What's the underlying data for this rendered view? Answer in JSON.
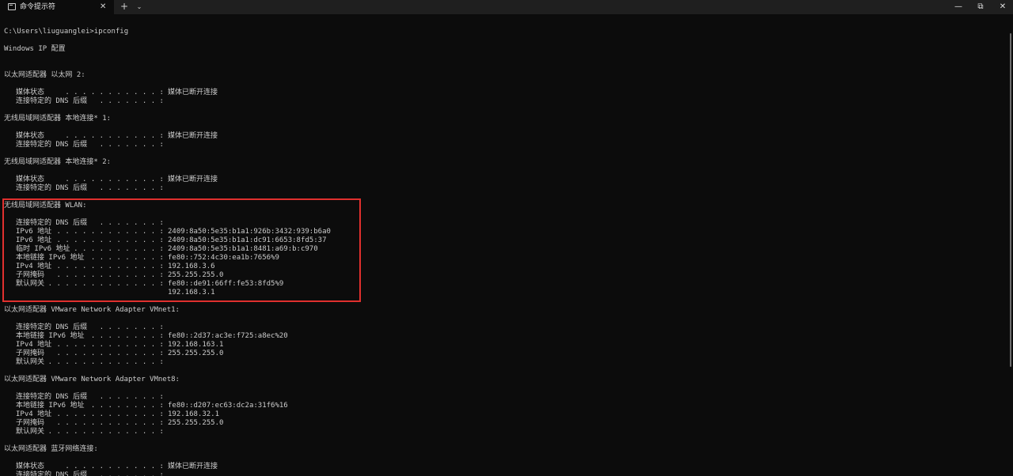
{
  "window": {
    "tab_title": "命令提示符",
    "tab_close": "✕",
    "new_tab": "+",
    "tab_dropdown": "⌄",
    "minimize": "—",
    "maximize": "⧉",
    "close": "✕"
  },
  "console": {
    "prompt": "C:\\Users\\liuguanglei>ipconfig",
    "heading": "Windows IP 配置",
    "adapters": [
      {
        "title": "以太网适配器 以太网 2:",
        "rows": [
          {
            "key": "媒体状态",
            "dots": ". . . . . . . . . . . :",
            "value": "媒体已断开连接"
          },
          {
            "key": "连接特定的 DNS 后缀",
            "dots": ". . . . . . . :",
            "value": ""
          }
        ]
      },
      {
        "title": "无线局域网适配器 本地连接* 1:",
        "rows": [
          {
            "key": "媒体状态",
            "dots": ". . . . . . . . . . . :",
            "value": "媒体已断开连接"
          },
          {
            "key": "连接特定的 DNS 后缀",
            "dots": ". . . . . . . :",
            "value": ""
          }
        ]
      },
      {
        "title": "无线局域网适配器 本地连接* 2:",
        "rows": [
          {
            "key": "媒体状态",
            "dots": ". . . . . . . . . . . :",
            "value": "媒体已断开连接"
          },
          {
            "key": "连接特定的 DNS 后缀",
            "dots": ". . . . . . . :",
            "value": ""
          }
        ]
      },
      {
        "title": "无线局域网适配器 WLAN:",
        "rows": [
          {
            "key": "连接特定的 DNS 后缀",
            "dots": ". . . . . . . :",
            "value": ""
          },
          {
            "key": "IPv6 地址",
            "dots": ". . . . . . . . . . . . :",
            "value": "2409:8a50:5e35:b1a1:926b:3432:939:b6a0"
          },
          {
            "key": "IPv6 地址",
            "dots": ". . . . . . . . . . . . :",
            "value": "2409:8a50:5e35:b1a1:dc91:6653:8fd5:37"
          },
          {
            "key": "临时 IPv6 地址",
            "dots": ". . . . . . . . . . :",
            "value": "2409:8a50:5e35:b1a1:8481:a69:b:c970"
          },
          {
            "key": "本地链接 IPv6 地址",
            "dots": ". . . . . . . . :",
            "value": "fe80::752:4c30:ea1b:7656%9"
          },
          {
            "key": "IPv4 地址",
            "dots": ". . . . . . . . . . . . :",
            "value": "192.168.3.6"
          },
          {
            "key": "子网掩码",
            "dots": ". . . . . . . . . . . . :",
            "value": "255.255.255.0"
          },
          {
            "key": "默认网关",
            "dots": ". . . . . . . . . . . . . :",
            "value": "fe80::de91:66ff:fe53:8fd5%9"
          },
          {
            "key": "",
            "dots": "",
            "value": "192.168.3.1"
          }
        ]
      },
      {
        "title": "以太网适配器 VMware Network Adapter VMnet1:",
        "rows": [
          {
            "key": "连接特定的 DNS 后缀",
            "dots": ". . . . . . . :",
            "value": ""
          },
          {
            "key": "本地链接 IPv6 地址",
            "dots": ". . . . . . . . :",
            "value": "fe80::2d37:ac3e:f725:a8ec%20"
          },
          {
            "key": "IPv4 地址",
            "dots": ". . . . . . . . . . . . :",
            "value": "192.168.163.1"
          },
          {
            "key": "子网掩码",
            "dots": ". . . . . . . . . . . . :",
            "value": "255.255.255.0"
          },
          {
            "key": "默认网关",
            "dots": ". . . . . . . . . . . . . :",
            "value": ""
          }
        ]
      },
      {
        "title": "以太网适配器 VMware Network Adapter VMnet8:",
        "rows": [
          {
            "key": "连接特定的 DNS 后缀",
            "dots": ". . . . . . . :",
            "value": ""
          },
          {
            "key": "本地链接 IPv6 地址",
            "dots": ". . . . . . . . :",
            "value": "fe80::d207:ec63:dc2a:31f6%16"
          },
          {
            "key": "IPv4 地址",
            "dots": ". . . . . . . . . . . . :",
            "value": "192.168.32.1"
          },
          {
            "key": "子网掩码",
            "dots": ". . . . . . . . . . . . :",
            "value": "255.255.255.0"
          },
          {
            "key": "默认网关",
            "dots": ". . . . . . . . . . . . . :",
            "value": ""
          }
        ]
      },
      {
        "title": "以太网适配器 蓝牙网络连接:",
        "rows": [
          {
            "key": "媒体状态",
            "dots": ". . . . . . . . . . . :",
            "value": "媒体已断开连接"
          },
          {
            "key": "连接特定的 DNS 后缀",
            "dots": ". . . . . . . :",
            "value": ""
          }
        ]
      }
    ]
  },
  "colors": {
    "background": "#0c0c0c",
    "text": "#cccccc",
    "highlight": "#e0302e",
    "titlebar": "#1f1f1f"
  }
}
